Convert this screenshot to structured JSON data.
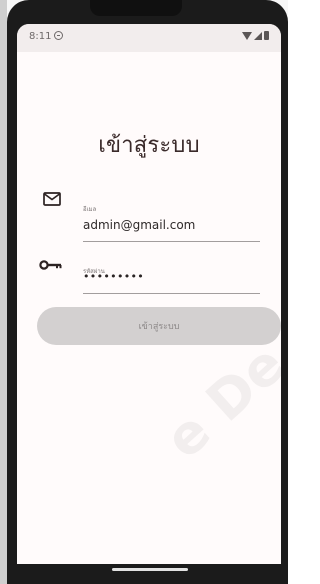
{
  "status_bar": {
    "time": "8:11"
  },
  "login": {
    "title": "เข้าสู่ระบบ",
    "email_label": "อีเมล",
    "email_value": "admin@gmail.com",
    "password_label": "รหัสผ่าน",
    "password_value": "•••••••••",
    "submit_label": "เข้าสู่ระบบ"
  },
  "icons": {
    "email": "mail-icon",
    "password": "key-icon"
  }
}
